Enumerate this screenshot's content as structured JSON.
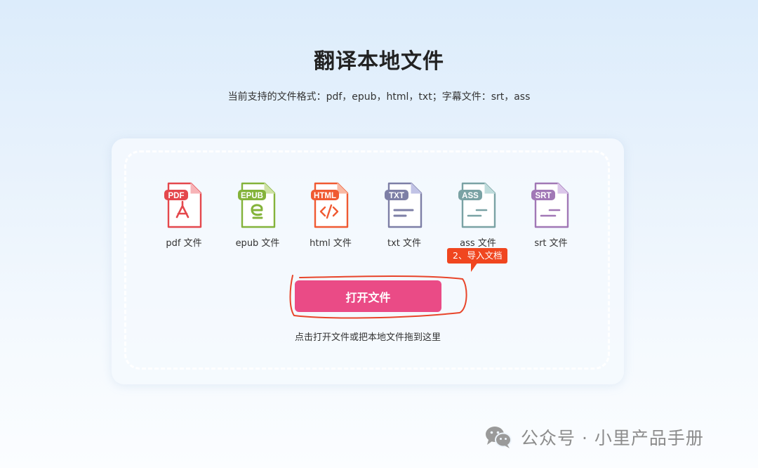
{
  "header": {
    "title": "翻译本地文件",
    "subtitle": "当前支持的文件格式：pdf，epub，html，txt；字幕文件：srt，ass"
  },
  "formats": [
    {
      "badge": "PDF",
      "label": "pdf 文件",
      "color": "#e4484d",
      "fold": "#f7b3b7",
      "icon": "pdf-file-icon"
    },
    {
      "badge": "EPUB",
      "label": "epub 文件",
      "color": "#84b33a",
      "fold": "#cfe3a4",
      "icon": "epub-file-icon"
    },
    {
      "badge": "HTML",
      "label": "html 文件",
      "color": "#f05a32",
      "fold": "#f9b9a3",
      "icon": "html-file-icon"
    },
    {
      "badge": "TXT",
      "label": "txt 文件",
      "color": "#7d7fa6",
      "fold": "#c1c3e6",
      "icon": "txt-file-icon"
    },
    {
      "badge": "ASS",
      "label": "ass 文件",
      "color": "#7aa2a4",
      "fold": "#bfdcdc",
      "icon": "ass-file-icon"
    },
    {
      "badge": "SRT",
      "label": "srt 文件",
      "color": "#a178b6",
      "fold": "#dbc6ea",
      "icon": "srt-file-icon"
    }
  ],
  "annotation": {
    "tooltip": "2、导入文档",
    "color": "#f0461f"
  },
  "upload": {
    "button_label": "打开文件",
    "button_color": "#ea4b86",
    "hint": "点击打开文件或把本地文件拖到这里"
  },
  "watermark": {
    "text": "公众号 · 小里产品手册",
    "icon": "wechat-icon"
  }
}
